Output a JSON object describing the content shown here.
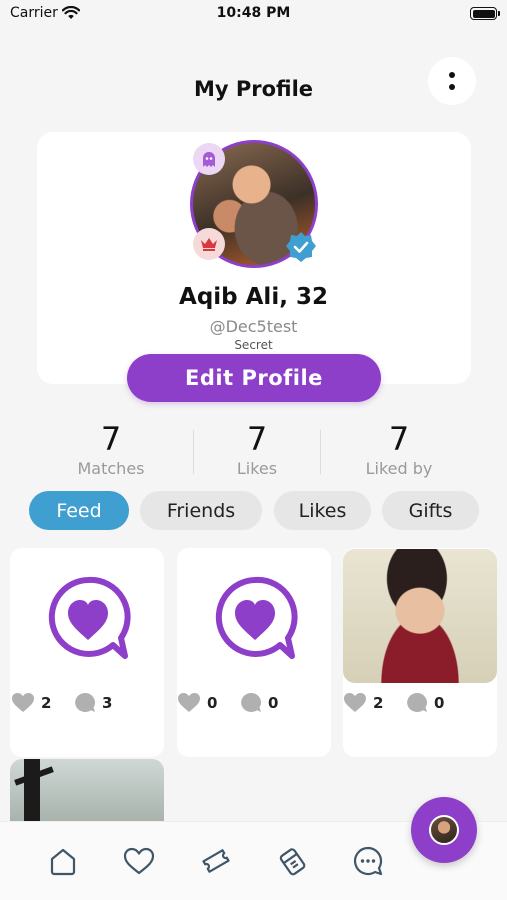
{
  "status_bar": {
    "carrier": "Carrier",
    "time": "10:48 PM"
  },
  "header": {
    "title": "My Profile",
    "menu_icon": "more-vertical-icon"
  },
  "profile": {
    "name": "Aqib Ali, 32",
    "username": "@Dec5test",
    "privacy": "Secret",
    "edit_label": "Edit Profile",
    "badges": [
      "ghost-icon",
      "crown-icon",
      "verified-icon"
    ]
  },
  "stats": [
    {
      "value": "7",
      "label": "Matches"
    },
    {
      "value": "7",
      "label": "Likes"
    },
    {
      "value": "7",
      "label": "Liked by"
    }
  ],
  "tabs": [
    {
      "label": "Feed",
      "active": true
    },
    {
      "label": "Friends",
      "active": false
    },
    {
      "label": "Likes",
      "active": false
    },
    {
      "label": "Gifts",
      "active": false
    }
  ],
  "posts": [
    {
      "type": "placeholder",
      "likes": "2",
      "comments": "3"
    },
    {
      "type": "placeholder",
      "likes": "0",
      "comments": "0"
    },
    {
      "type": "photo",
      "likes": "2",
      "comments": "0"
    },
    {
      "type": "photo"
    }
  ],
  "bottom_nav": [
    "home-icon",
    "heart-icon",
    "ticket-icon",
    "gift-icon",
    "chat-icon"
  ],
  "colors": {
    "accent": "#8d3fca",
    "active_tab": "#3f9fd1",
    "verified": "#3f9fd1"
  }
}
